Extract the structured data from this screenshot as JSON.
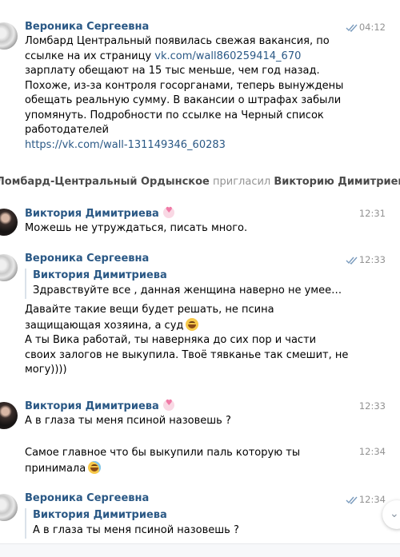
{
  "messages": [
    {
      "author": "Вероника Сергеевна",
      "time": "04:12",
      "lines": [
        "Ломбард Центральный  появилась свежая вакансия, по",
        "ссылке на их страницу ",
        "зарплату обещают на 15 тыс меньше, чем год назад.",
        "Похоже, из-за контроля госорганами, теперь вынуждены",
        "обещать реальную сумму. В вакансии о штрафах забыли",
        "упомянуть. Подробности по ссылке на Черный список",
        "работодателей"
      ],
      "inline_link": "vk.com/wall860259414_670",
      "link": "https://vk.com/wall-131149346_60283"
    },
    {
      "service_actor": "Ломбард-Центральный Ордынское",
      "service_verb": " пригласил ",
      "service_target": "Викторию Димитриеву"
    },
    {
      "author": "Виктория Димитриева",
      "time": "12:31",
      "text": "Можешь не утруждаться, писать много."
    },
    {
      "author": "Вероника Сергеевна",
      "time": "12:33",
      "quote_author": "Виктория Димитриева",
      "quote_text": "Здравствуйте все , данная женщина наверно не умее…",
      "lines": [
        "Давайте такие вещи будет решать, не псина",
        "защищающая хозяина, а суд",
        "А ты Вика работай, ты наверняка до сих пор и части",
        "своих залогов не выкупила. Твоё тявканье так смешит, не",
        "могу))))"
      ]
    },
    {
      "author": "Виктория Димитриева",
      "time": "12:33",
      "text": "А в глаза ты меня псиной назовешь ?",
      "time2": "12:34",
      "lines2": [
        "Самое главное что бы выкупили паль которую ты",
        "принимала"
      ]
    },
    {
      "author": "Вероника Сергеевна",
      "time": "12:34",
      "quote_author": "Виктория Димитриева",
      "quote_text": "А в глаза ты меня псиной назовешь ?"
    }
  ],
  "icons": {
    "read_ticks": "double-check-icon",
    "heart_emoji": "heart-emoji-icon",
    "grin_emoji": "grinning-emoji-icon",
    "laugh_emoji": "tears-of-joy-emoji-icon",
    "scroll_down": "chevron-down-icon"
  },
  "colors": {
    "author": "#2a5885",
    "time": "#939393",
    "quote_border": "#dae2ea"
  }
}
